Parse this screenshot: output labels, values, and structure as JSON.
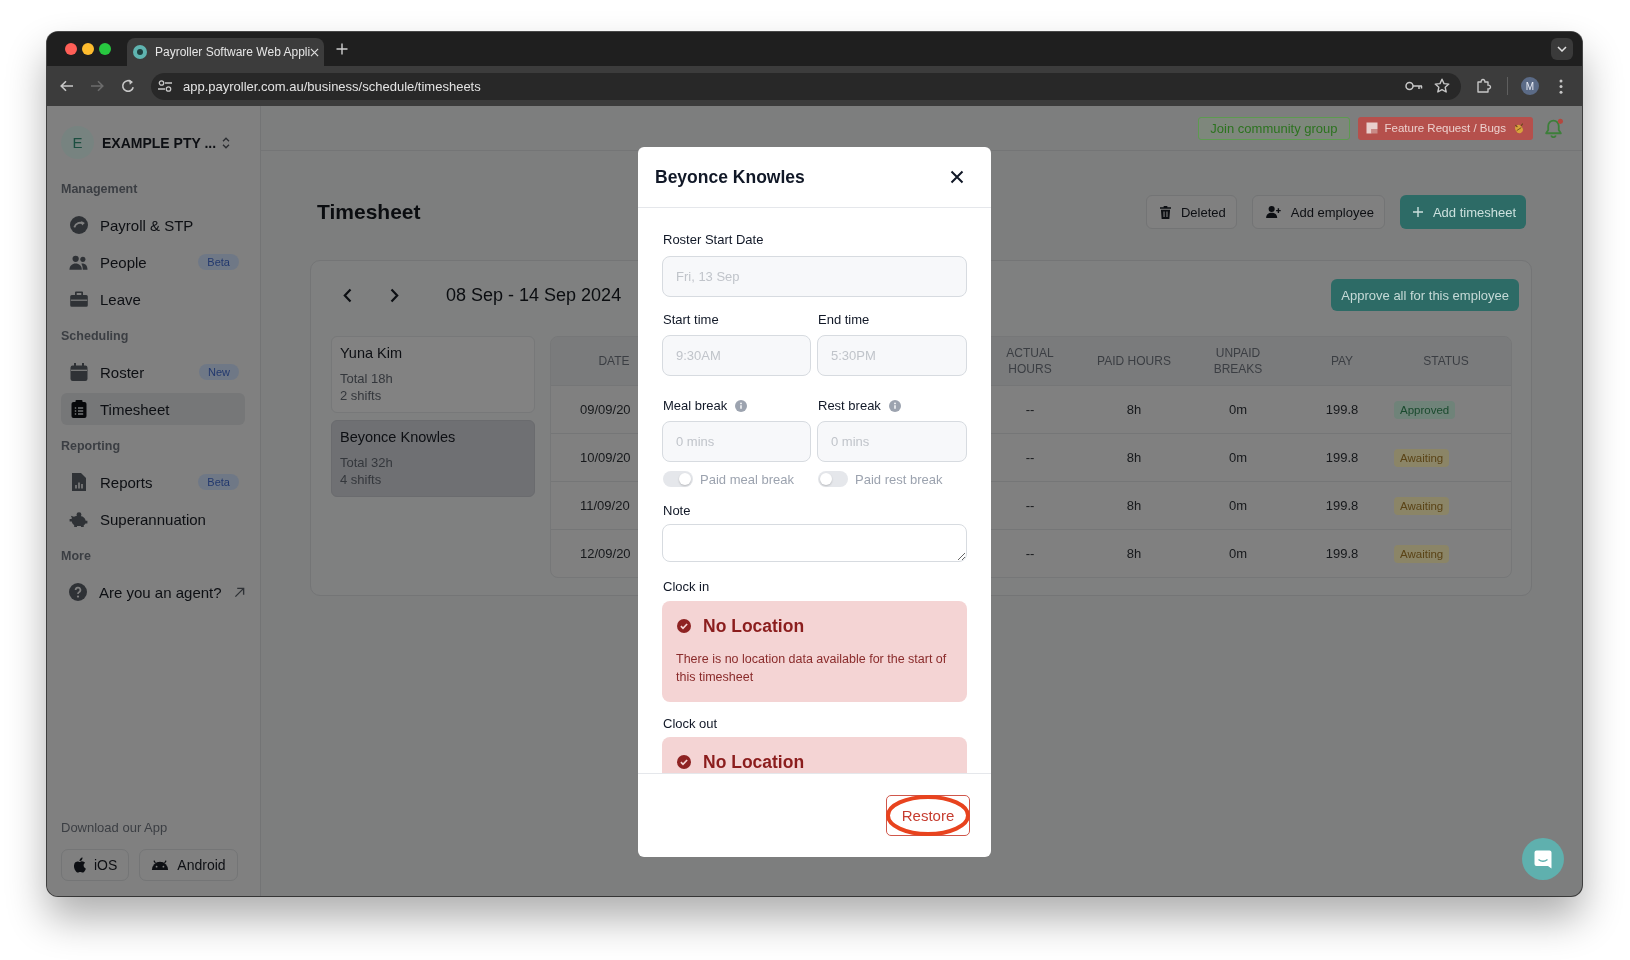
{
  "browser": {
    "tab_title": "Payroller Software Web Appli",
    "url": "app.payroller.com.au/business/schedule/timesheets",
    "profile_initial": "M"
  },
  "sidebar": {
    "org_initial": "E",
    "org_name": "EXAMPLE PTY ...",
    "sections": [
      {
        "title": "Management",
        "items": [
          {
            "label": "Payroll & STP",
            "kind": "page",
            "selected": false
          },
          {
            "label": "People",
            "kind": "page",
            "badge": "Beta",
            "selected": false
          },
          {
            "label": "Leave",
            "kind": "page",
            "selected": false
          }
        ]
      },
      {
        "title": "Scheduling",
        "items": [
          {
            "label": "Roster",
            "kind": "page",
            "badge": "New",
            "selected": false
          },
          {
            "label": "Timesheet",
            "kind": "page",
            "selected": true
          }
        ]
      },
      {
        "title": "Reporting",
        "items": [
          {
            "label": "Reports",
            "kind": "page",
            "badge": "Beta",
            "selected": false
          },
          {
            "label": "Superannuation",
            "kind": "page",
            "selected": false
          }
        ]
      },
      {
        "title": "More",
        "items": [
          {
            "label": "Are you an agent?",
            "kind": "external",
            "selected": false
          }
        ]
      }
    ],
    "download": {
      "label": "Download our App",
      "buttons": [
        "iOS",
        "Android"
      ]
    }
  },
  "top_bar": {
    "buttons": [
      {
        "label": "Join community group",
        "kind": "community"
      },
      {
        "label": "Feature Request / Bugs",
        "kind": "feedback"
      }
    ]
  },
  "page": {
    "title": "Timesheet",
    "actions": [
      {
        "label": "Deleted",
        "kind": "secondary"
      },
      {
        "label": "Add employee",
        "kind": "secondary"
      },
      {
        "label": "Add timesheet",
        "kind": "primary"
      }
    ]
  },
  "timesheet_panel": {
    "week": "08 Sep - 14 Sep 2024",
    "approve_button": "Approve all for this employee",
    "employees": [
      {
        "name": "Yuna Kim",
        "total": "Total 18h",
        "shifts": "2 shifts",
        "selected": false
      },
      {
        "name": "Beyonce Knowles",
        "total": "Total 32h",
        "shifts": "4 shifts",
        "selected": true
      }
    ],
    "table": {
      "columns": [
        "DATE",
        "ACTUAL HOURS",
        "PAID HOURS",
        "UNPAID BREAKS",
        "PAY",
        "STATUS"
      ],
      "rows": [
        {
          "date": "09/09/20",
          "actual_hours": "--",
          "paid_hours": "8h",
          "unpaid_breaks": "0m",
          "pay": "199.8",
          "status": {
            "label": "Approved",
            "kind": "approved"
          }
        },
        {
          "date": "10/09/20",
          "actual_hours": "--",
          "paid_hours": "8h",
          "unpaid_breaks": "0m",
          "pay": "199.8",
          "status": {
            "label": "Awaiting",
            "kind": "awaiting"
          }
        },
        {
          "date": "11/09/20",
          "actual_hours": "--",
          "paid_hours": "8h",
          "unpaid_breaks": "0m",
          "pay": "199.8",
          "status": {
            "label": "Awaiting",
            "kind": "awaiting"
          }
        },
        {
          "date": "12/09/20",
          "actual_hours": "--",
          "paid_hours": "8h",
          "unpaid_breaks": "0m",
          "pay": "199.8",
          "status": {
            "label": "Awaiting",
            "kind": "awaiting"
          }
        }
      ]
    }
  },
  "modal": {
    "title": "Beyonce Knowles",
    "roster_start_date": {
      "label": "Roster Start Date",
      "value": "Fri, 13 Sep",
      "disabled": true
    },
    "start_time": {
      "label": "Start time",
      "value": "9:30AM",
      "disabled": true
    },
    "end_time": {
      "label": "End time",
      "value": "5:30PM",
      "disabled": true
    },
    "meal_break": {
      "label": "Meal break",
      "value": "0 mins",
      "disabled": true
    },
    "rest_break": {
      "label": "Rest break",
      "value": "0 mins",
      "disabled": true
    },
    "toggles": [
      {
        "label": "Paid meal break",
        "on": true,
        "disabled": true
      },
      {
        "label": "Paid rest break",
        "on": false,
        "disabled": true
      }
    ],
    "note": {
      "label": "Note"
    },
    "clock_in": {
      "label": "Clock in",
      "title": "No Location",
      "message": "There is no location data available for the start of this timesheet"
    },
    "clock_out": {
      "label": "Clock out",
      "title": "No Location"
    },
    "restore_button": "Restore"
  }
}
